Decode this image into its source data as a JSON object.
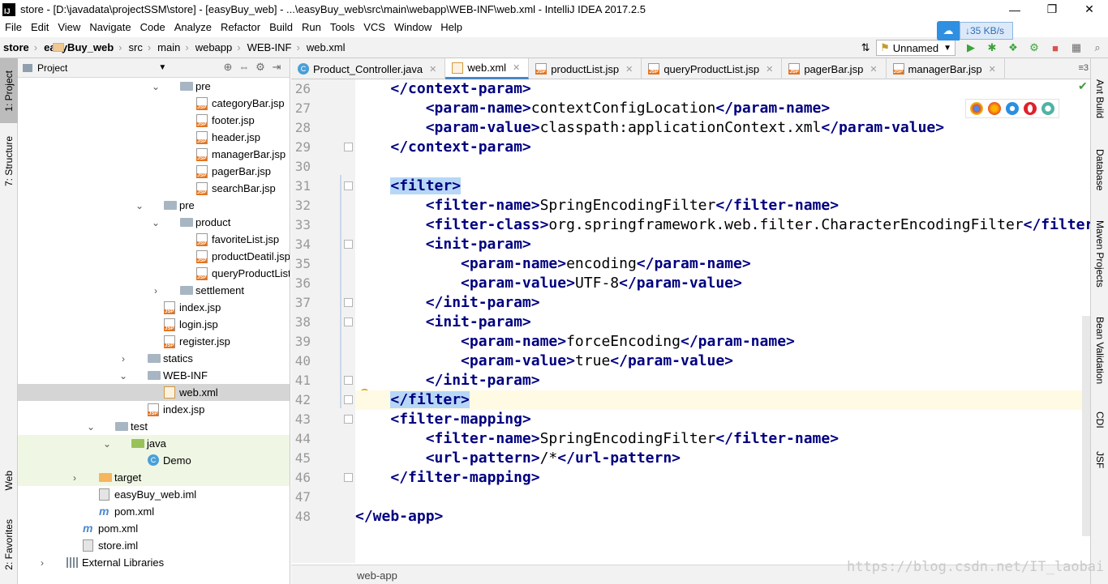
{
  "window": {
    "title": "store - [D:\\javadata\\projectSSM\\store] - [easyBuy_web] - ...\\easyBuy_web\\src\\main\\webapp\\WEB-INF\\web.xml - IntelliJ IDEA 2017.2.5",
    "min": "—",
    "max": "❐",
    "close": "✕"
  },
  "menu": [
    "File",
    "Edit",
    "View",
    "Navigate",
    "Code",
    "Analyze",
    "Refactor",
    "Build",
    "Run",
    "Tools",
    "VCS",
    "Window",
    "Help"
  ],
  "net": {
    "speed": "↓35 KB/s"
  },
  "breadcrumb": [
    "store",
    "easyBuy_web",
    "src",
    "main",
    "webapp",
    "WEB-INF",
    "web.xml"
  ],
  "toolbar": {
    "run_config": "Unnamed"
  },
  "left_tabs": [
    "1: Project",
    "7: Structure",
    "Web",
    "2: Favorites"
  ],
  "right_tabs": [
    "Ant Build",
    "Database",
    "Maven Projects",
    "Bean Validation",
    "CDI",
    "JSF"
  ],
  "project": {
    "header": "Project",
    "tree": [
      {
        "label": "pre",
        "arrow": "⌄",
        "icon": "folder",
        "indent": 1
      },
      {
        "label": "categoryBar.jsp",
        "icon": "jsp",
        "indent": 2
      },
      {
        "label": "footer.jsp",
        "icon": "jsp",
        "indent": 2
      },
      {
        "label": "header.jsp",
        "icon": "jsp",
        "indent": 2
      },
      {
        "label": "managerBar.jsp",
        "icon": "jsp",
        "indent": 2
      },
      {
        "label": "pagerBar.jsp",
        "icon": "jsp",
        "indent": 2
      },
      {
        "label": "searchBar.jsp",
        "icon": "jsp",
        "indent": 2
      },
      {
        "label": "pre",
        "arrow": "⌄",
        "icon": "folder",
        "indent": 0
      },
      {
        "label": "product",
        "arrow": "⌄",
        "icon": "folder",
        "indent": 1
      },
      {
        "label": "favoriteList.jsp",
        "icon": "jsp",
        "indent": 2
      },
      {
        "label": "productDeatil.jsp",
        "icon": "jsp",
        "indent": 2
      },
      {
        "label": "queryProductList.jsp",
        "icon": "jsp",
        "indent": 2
      },
      {
        "label": "settlement",
        "arrow": "›",
        "icon": "folder",
        "indent": 1
      },
      {
        "label": "index.jsp",
        "icon": "jsp",
        "indent": 0
      },
      {
        "label": "login.jsp",
        "icon": "jsp",
        "indent": 0
      },
      {
        "label": "register.jsp",
        "icon": "jsp",
        "indent": 0
      },
      {
        "label": "statics",
        "arrow": "›",
        "icon": "folder",
        "indent": -1
      },
      {
        "label": "WEB-INF",
        "arrow": "⌄",
        "icon": "folder",
        "indent": -1
      },
      {
        "label": "web.xml",
        "icon": "xml",
        "indent": 0,
        "selected": true
      },
      {
        "label": "index.jsp",
        "icon": "jsp",
        "indent": -1
      },
      {
        "label": "test",
        "arrow": "⌄",
        "icon": "folder",
        "indent": -3
      },
      {
        "label": "java",
        "arrow": "⌄",
        "icon": "folder-g",
        "indent": -2,
        "green": true
      },
      {
        "label": "Demo",
        "icon": "cls",
        "indent": -1,
        "green": true
      },
      {
        "label": "target",
        "arrow": "›",
        "icon": "folder-o",
        "indent": -4,
        "green": true
      },
      {
        "label": "easyBuy_web.iml",
        "icon": "iml",
        "indent": -4
      },
      {
        "label": "pom.xml",
        "icon": "mvn",
        "indent": -4
      },
      {
        "label": "pom.xml",
        "icon": "mvn",
        "indent": -5
      },
      {
        "label": "store.iml",
        "icon": "iml",
        "indent": -5
      },
      {
        "label": "External Libraries",
        "arrow": "›",
        "icon": "lib",
        "indent": -6
      }
    ]
  },
  "editor": {
    "tabs": [
      {
        "label": "Product_Controller.java",
        "icon": "c"
      },
      {
        "label": "web.xml",
        "icon": "x",
        "active": true
      },
      {
        "label": "productList.jsp",
        "icon": "j"
      },
      {
        "label": "queryProductList.jsp",
        "icon": "j"
      },
      {
        "label": "pagerBar.jsp",
        "icon": "j"
      },
      {
        "label": "managerBar.jsp",
        "icon": "j"
      }
    ],
    "tabs_more": "≡3",
    "lines": [
      {
        "n": "26",
        "indent": 1,
        "parts": [
          [
            "tag",
            "</context-param>"
          ]
        ]
      },
      {
        "n": "27",
        "indent": 2,
        "parts": [
          [
            "tag",
            "<param-name>"
          ],
          [
            "txt",
            "contextConfigLocation"
          ],
          [
            "tag",
            "</param-name>"
          ]
        ]
      },
      {
        "n": "28",
        "indent": 2,
        "parts": [
          [
            "tag",
            "<param-value>"
          ],
          [
            "txt",
            "classpath:applicationContext.xml"
          ],
          [
            "tag",
            "</param-value>"
          ]
        ]
      },
      {
        "n": "29",
        "indent": 1,
        "parts": [
          [
            "tag",
            "</context-param>"
          ]
        ]
      },
      {
        "n": "30",
        "indent": 0,
        "parts": []
      },
      {
        "n": "31",
        "indent": 1,
        "parts": [
          [
            "tsel",
            "<filter>"
          ]
        ]
      },
      {
        "n": "32",
        "indent": 2,
        "parts": [
          [
            "tag",
            "<filter-name>"
          ],
          [
            "txt",
            "SpringEncodingFilter"
          ],
          [
            "tag",
            "</filter-name>"
          ]
        ]
      },
      {
        "n": "33",
        "indent": 2,
        "parts": [
          [
            "tag",
            "<filter-class>"
          ],
          [
            "txt",
            "org.springframework.web.filter.CharacterEncodingFilter"
          ],
          [
            "tag",
            "</filter-class>"
          ]
        ]
      },
      {
        "n": "34",
        "indent": 2,
        "parts": [
          [
            "tag",
            "<init-param>"
          ]
        ]
      },
      {
        "n": "35",
        "indent": 3,
        "parts": [
          [
            "tag",
            "<param-name>"
          ],
          [
            "txt",
            "encoding"
          ],
          [
            "tag",
            "</param-name>"
          ]
        ]
      },
      {
        "n": "36",
        "indent": 3,
        "parts": [
          [
            "tag",
            "<param-value>"
          ],
          [
            "txt",
            "UTF-8"
          ],
          [
            "tag",
            "</param-value>"
          ]
        ]
      },
      {
        "n": "37",
        "indent": 2,
        "parts": [
          [
            "tag",
            "</init-param>"
          ]
        ]
      },
      {
        "n": "38",
        "indent": 2,
        "parts": [
          [
            "tag",
            "<init-param>"
          ]
        ]
      },
      {
        "n": "39",
        "indent": 3,
        "parts": [
          [
            "tag",
            "<param-name>"
          ],
          [
            "txt",
            "forceEncoding"
          ],
          [
            "tag",
            "</param-name>"
          ]
        ]
      },
      {
        "n": "40",
        "indent": 3,
        "parts": [
          [
            "tag",
            "<param-value>"
          ],
          [
            "txt",
            "true"
          ],
          [
            "tag",
            "</param-value>"
          ]
        ]
      },
      {
        "n": "41",
        "indent": 2,
        "parts": [
          [
            "tag",
            "</init-param>"
          ]
        ]
      },
      {
        "n": "42",
        "indent": 1,
        "parts": [
          [
            "tsel",
            "</filter>"
          ]
        ],
        "highlight": true
      },
      {
        "n": "43",
        "indent": 1,
        "parts": [
          [
            "tag",
            "<filter-mapping>"
          ]
        ]
      },
      {
        "n": "44",
        "indent": 2,
        "parts": [
          [
            "tag",
            "<filter-name>"
          ],
          [
            "txt",
            "SpringEncodingFilter"
          ],
          [
            "tag",
            "</filter-name>"
          ]
        ]
      },
      {
        "n": "45",
        "indent": 2,
        "parts": [
          [
            "tag",
            "<url-pattern>"
          ],
          [
            "txt",
            "/*"
          ],
          [
            "tag",
            "</url-pattern>"
          ]
        ]
      },
      {
        "n": "46",
        "indent": 1,
        "parts": [
          [
            "tag",
            "</filter-mapping>"
          ]
        ]
      },
      {
        "n": "47",
        "indent": 0,
        "parts": []
      },
      {
        "n": "48",
        "indent": 0,
        "parts": [
          [
            "tag",
            "</web-app>"
          ]
        ]
      }
    ]
  },
  "statusbar": {
    "crumbs": "web-app"
  },
  "watermark": "https://blog.csdn.net/IT_laobai",
  "colors": {
    "tag": "#000080",
    "selection": "#b7d7f6",
    "line_highlight": "#fffae3"
  }
}
